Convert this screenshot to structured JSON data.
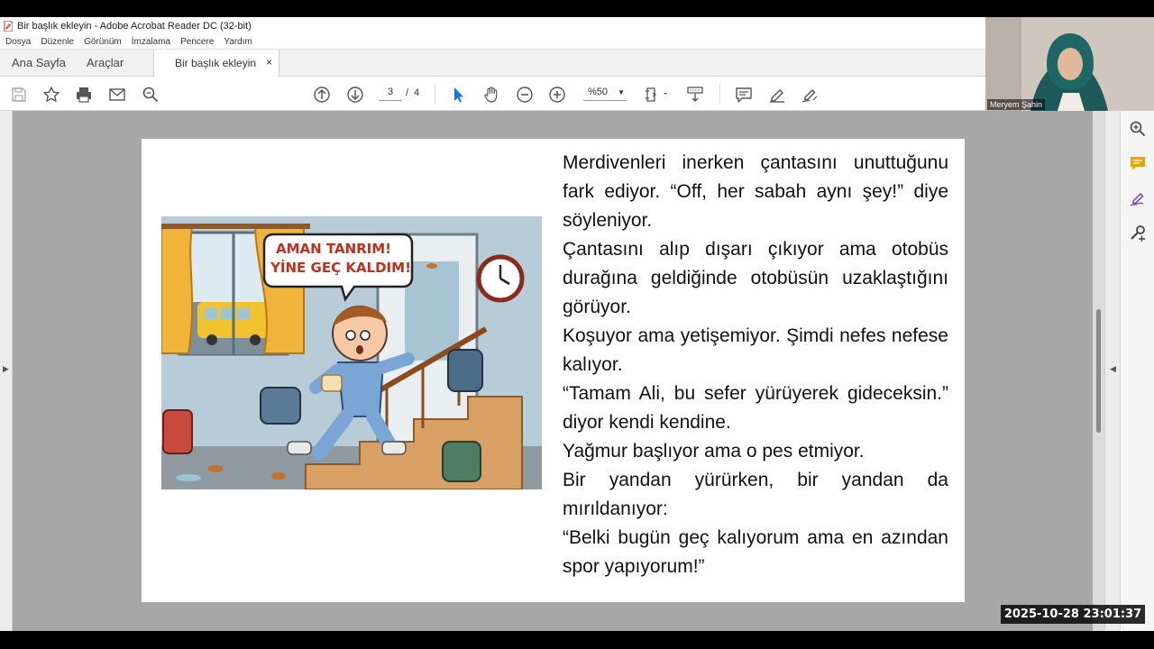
{
  "window": {
    "title": "Bir başlık ekleyin - Adobe Acrobat Reader DC (32-bit)"
  },
  "menu": [
    "Dosya",
    "Düzenle",
    "Görünüm",
    "İmzalama",
    "Pencere",
    "Yardım"
  ],
  "tabs": {
    "home": "Ana Sayfa",
    "tools": "Araçlar",
    "document": "Bir başlık ekleyin",
    "close": "×"
  },
  "toolbar": {
    "current_page": "3",
    "page_separator": "/",
    "total_pages": "4",
    "zoom": "%50"
  },
  "document": {
    "illustration": {
      "speech_line1": "AMAN TANRIM!",
      "speech_line2": "YİNE GEÇ KALDIM!"
    },
    "paragraphs": [
      "Merdivenleri inerken çantasını unuttuğunu fark ediyor. “Off, her sabah aynı şey!” diye söyleniyor.",
      " Çantasını alıp dışarı çıkıyor ama otobüs durağına geldiğinde otobüsün uzaklaştığını görüyor.",
      " Koşuyor ama yetişemiyor. Şimdi nefes nefese kalıyor.",
      "  “Tamam Ali, bu sefer yürüyerek gideceksin.” diyor kendi kendine.",
      " Yağmur başlıyor ama o pes etmiyor.",
      " Bir yandan yürürken, bir yandan da mırıldanıyor:",
      " “Belki bugün geç kalıyorum ama en azından spor yapıyorum!”"
    ]
  },
  "webcam": {
    "participant_name": "Meryem Şahin"
  },
  "overlay": {
    "timestamp": "2025-10-28  23:01:37"
  },
  "colors": {
    "pdf_red": "#d9261c",
    "tool_blue": "#1473e6",
    "comment_yellow": "#e8a500",
    "sign_purple": "#7b3fb8",
    "document_background": "#a7a7a7"
  }
}
